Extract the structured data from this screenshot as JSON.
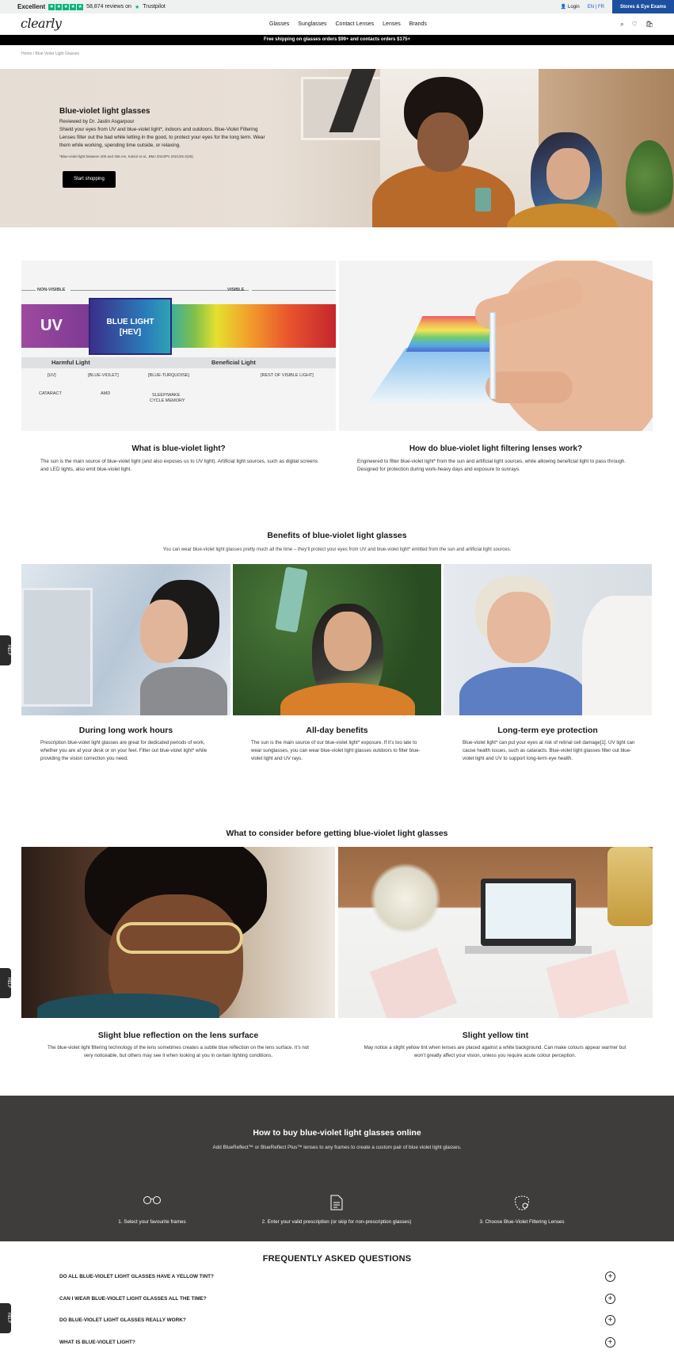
{
  "topbar": {
    "trustpilot_label": "Excellent",
    "stars": [
      "★",
      "★",
      "★",
      "★",
      "★"
    ],
    "reviews": "58,874 reviews on",
    "trustpilot": "Trustpilot",
    "login": "Login",
    "lang_en": "EN",
    "lang_sep": "|",
    "lang_fr": "FR",
    "stores": "Stores & Eye Exams"
  },
  "header": {
    "logo": "clearly",
    "nav": [
      "Glasses",
      "Sunglasses",
      "Contact Lenses",
      "Lenses",
      "Brands"
    ],
    "icons": [
      "search-icon",
      "heart-icon",
      "cart-icon"
    ]
  },
  "promo": "Free shipping on glasses orders $99+ and contacts orders $175+",
  "breadcrumb": "Home / Blue Violet Light Glasses",
  "hero": {
    "title": "Blue-violet light glasses",
    "reviewed": "Reviewed by Dr. Jastin Asgarpour",
    "description": "Shield your eyes from UV and blue-violet light*, indoors and outdoors. Blue-Violet Filtering Lenses filter out the bad while letting in the good, to protect your eyes for the long term. Wear them while working, spending time outside, or relaxing.",
    "note": "*Blue-violet light between 400 and 455 nm, Kokiol et al., BMJ 2024/Ps 2021/25-2(26)",
    "button": "Start shopping"
  },
  "spectrum": {
    "non_visible": "NON-VISIBLE",
    "visible": "VISIBLE",
    "uv": "UV",
    "blue_light": "BLUE LIGHT",
    "hev": "[HEV]",
    "harmful": "Harmful Light",
    "beneficial": "Beneficial Light",
    "bands": [
      "[UV]",
      "[BLUE-VIOLET]",
      "[BLUE-TURQUOISE]",
      "[REST OF VISIBLE LIGHT]"
    ],
    "effects": [
      "CATARACT",
      "AMD",
      "SLEEP/WAKE",
      "CYCLE MEMORY"
    ]
  },
  "info": [
    {
      "title": "What is blue-violet light?",
      "text": "The sun is the main source of blue-violet light (and also exposes us to UV light). Artificial light sources, such as digital screens and LED lights, also emit blue-violet light."
    },
    {
      "title": "How do blue-violet light filtering lenses work?",
      "text": "Engineered to filter blue-violet light* from the sun and artificial light sources, while allowing beneficial light to pass through. Designed for protection during work-heavy days and exposure to sunrays."
    }
  ],
  "benefits": {
    "title": "Benefits of blue-violet light glasses",
    "subtitle": "You can wear blue-violet light glasses pretty much all the time – they’ll protect your eyes from UV and blue-violet light* emitted from the sun and artificial light sources.",
    "items": [
      {
        "title": "During long work hours",
        "text": "Prescription blue-violet light glasses are great for dedicated periods of work, whether you are at your desk or on your feet. Filter out blue-violet light* while providing the vision correction you need."
      },
      {
        "title": "All-day benefits",
        "text": "The sun is the main source of our blue-violet light* exposure. If it’s too late to wear sunglasses, you can wear blue-violet light glasses outdoors to filter blue-violet light and UV rays."
      },
      {
        "title": "Long-term eye protection",
        "text": "Blue-violet light* can put your eyes at risk of retinal cell damage[1]. UV light can cause health issues, such as cataracts. Blue-violet light glasses filter out blue-violet light and UV to support long-term eye health."
      }
    ]
  },
  "consider": {
    "title": "What to consider before getting blue-violet light glasses",
    "items": [
      {
        "title": "Slight blue reflection on the lens surface",
        "text": "The blue-violet light filtering technology of the lens sometimes creates a subtle blue reflection on the lens surface. It’s not very noticeable, but others may see it when looking at you in certain lighting conditions."
      },
      {
        "title": "Slight yellow tint",
        "text": "May notice a slight yellow tint when lenses are placed against a white background. Can make colours appear warmer but won’t greatly affect your vision, unless you require acute colour perception."
      }
    ]
  },
  "buy": {
    "title": "How to buy blue-violet light glasses online",
    "subtitle": "Add BlueReflect™ or BlueReflect Plus™ lenses to any frames to create a custom pair of blue violet light glasses.",
    "steps": [
      {
        "icon": "glasses-icon",
        "text": "1. Select your favourite frames"
      },
      {
        "icon": "document-icon",
        "text": "2. Enter your valid prescription (or skip for non-prescription glasses)"
      },
      {
        "icon": "lens-icon",
        "text": "3. Choose Blue-Violet Filtering Lenses"
      }
    ]
  },
  "faq": {
    "title": "FREQUENTLY ASKED QUESTIONS",
    "items": [
      "DO ALL BLUE-VIOLET LIGHT GLASSES HAVE A YELLOW TINT?",
      "CAN I WEAR BLUE-VIOLET LIGHT GLASSES ALL THE TIME?",
      "DO BLUE-VIOLET LIGHT GLASSES REALLY WORK?",
      "WHAT IS BLUE-VIOLET LIGHT?"
    ]
  },
  "side_tab": "HELP"
}
